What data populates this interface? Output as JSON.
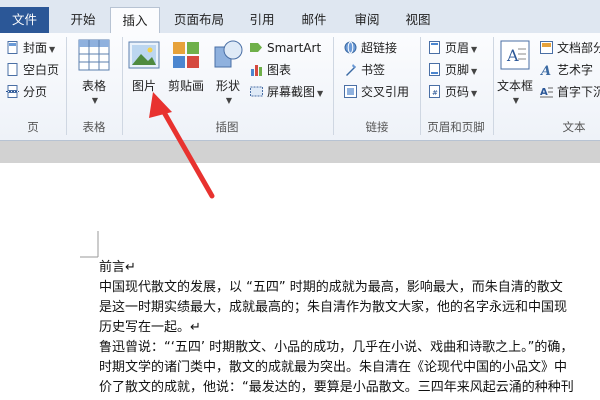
{
  "tabs": [
    "文件",
    "开始",
    "插入",
    "页面布局",
    "引用",
    "邮件",
    "审阅",
    "视图"
  ],
  "ribbon": {
    "pages": {
      "cover": "封面",
      "blank": "空白页",
      "break": "分页",
      "label": "页"
    },
    "tables": {
      "table": "表格",
      "label": "表格"
    },
    "illustrations": {
      "picture": "图片",
      "clipart": "剪贴画",
      "shapes": "形状",
      "smartart": "SmartArt",
      "chart": "图表",
      "screenshot": "屏幕截图",
      "label": "插图"
    },
    "links": {
      "hyperlink": "超链接",
      "bookmark": "书签",
      "crossref": "交叉引用",
      "label": "链接"
    },
    "header_footer": {
      "header": "页眉",
      "footer": "页脚",
      "page_number": "页码",
      "label": "页眉和页脚"
    },
    "text": {
      "textbox": "文本框",
      "quickparts": "文档部分",
      "wordart": "艺术字",
      "dropcap": "首字下沉",
      "label": "文本"
    }
  },
  "document": {
    "lines": [
      "前言↵",
      "中国现代散文的发展，以 “五四” 时期的成就为最高，影响最大，而朱自清的散文",
      "是这一时期实绩最大，成就最高的；朱自清作为散文大家，他的名字永远和中国现",
      "历史写在一起。↵",
      "鲁迅曾说：“‘五四’ 时期散文、小品的成功，几乎在小说、戏曲和诗歌之上。”的确，",
      "时期文学的诸门类中，散文的成就最为突出。朱自清在《论现代中国的小品文》中",
      "价了散文的成就，他说：“最发达的，要算是小品散文。三四年来风起云涌的种种刊"
    ]
  },
  "colors": {
    "file_tab": "#2b5797",
    "arrow": "#e8322f"
  }
}
